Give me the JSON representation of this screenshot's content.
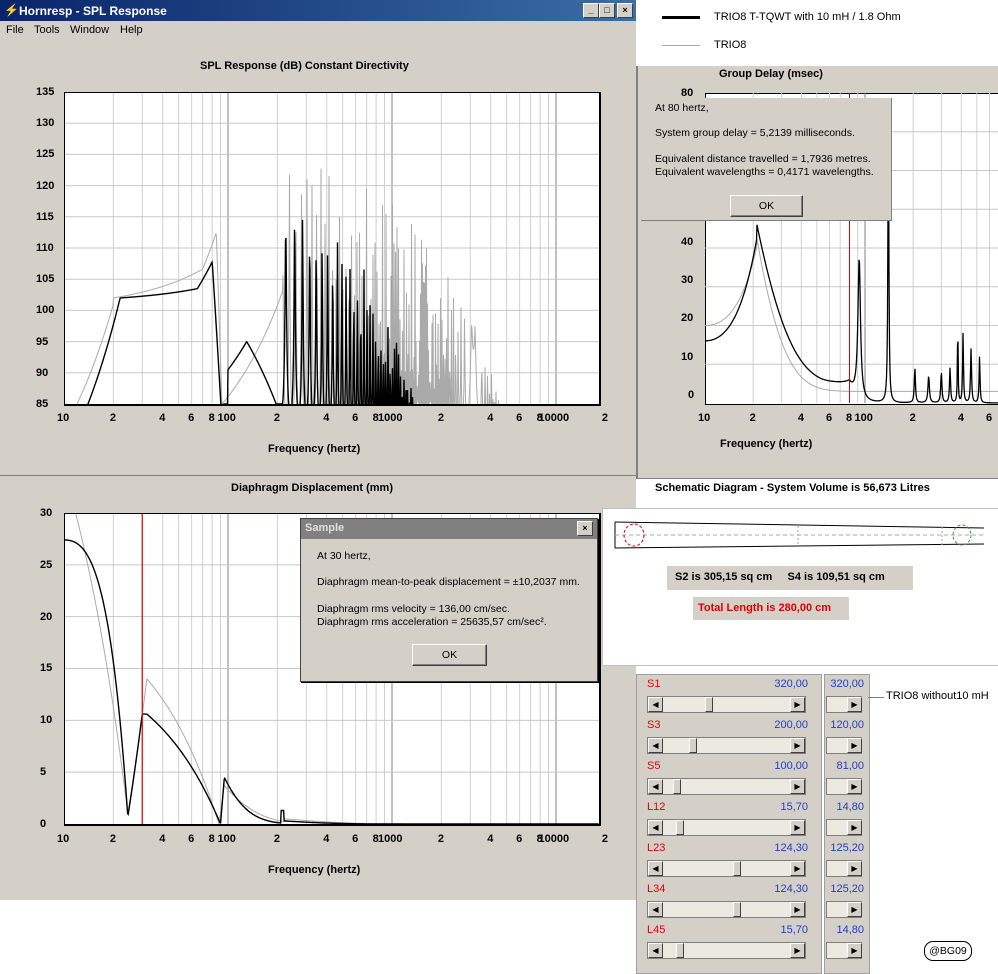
{
  "window": {
    "title": "Hornresp - SPL Response",
    "minimize": "_",
    "maximize": "□",
    "close": "×"
  },
  "menu": [
    "File",
    "Tools",
    "Window",
    "Help"
  ],
  "legend": {
    "series1": "TRIO8  T-TQWT with 10 mH / 1.8 Ohm",
    "series2": "TRIO8"
  },
  "colors": {
    "bg": "#d4d0c8",
    "plot_bg": "#ffffff",
    "series1": "#000000",
    "series2": "#aaaaaa",
    "marker": "#e00000",
    "title_bar": "#0a246a",
    "value_blue": "#1f3fbf"
  },
  "spl_chart": {
    "title": "SPL Response (dB)   Constant Directivity",
    "xlabel": "Frequency (hertz)",
    "y_ticks": [
      "135",
      "130",
      "125",
      "120",
      "115",
      "110",
      "105",
      "100",
      "95",
      "90",
      "85"
    ],
    "x_ticks": [
      "10",
      "2",
      "4",
      "6",
      "8",
      "100",
      "2",
      "4",
      "6",
      "8",
      "1000",
      "2",
      "4",
      "6",
      "8",
      "10000",
      "2"
    ]
  },
  "group_delay_chart": {
    "title": "Group Delay (msec)",
    "xlabel": "Frequency (hertz)",
    "y_ticks": [
      "80",
      "40",
      "30",
      "20",
      "10",
      "0"
    ],
    "x_ticks": [
      "10",
      "2",
      "4",
      "6",
      "8",
      "100",
      "2",
      "4",
      "6"
    ]
  },
  "gd_dialog": {
    "line1": "At 80 hertz,",
    "line2": "System group delay = 5,2139 milliseconds.",
    "line3": "Equivalent distance travelled = 1,7936 metres.",
    "line4": "Equivalent wavelengths = 0,4171 wavelengths.",
    "ok": "OK"
  },
  "disp_chart": {
    "title": "Diaphragm Displacement (mm)",
    "xlabel": "Frequency (hertz)",
    "y_ticks": [
      "30",
      "25",
      "20",
      "15",
      "10",
      "5",
      "0"
    ],
    "x_ticks": [
      "10",
      "2",
      "4",
      "6",
      "8",
      "100",
      "2",
      "4",
      "6",
      "8",
      "1000",
      "2",
      "4",
      "6",
      "8",
      "10000",
      "2"
    ]
  },
  "sample_dialog": {
    "title": "Sample",
    "close": "×",
    "line1": "At 30 hertz,",
    "line2": "Diaphragm mean-to-peak displacement = ±10,2037 mm.",
    "line3": "Diaphragm rms velocity = 136,00 cm/sec.",
    "line4": "Diaphragm rms acceleration = 25635,57 cm/sec².",
    "ok": "OK"
  },
  "schematic": {
    "title": "Schematic Diagram - System Volume is 56,673 Litres",
    "areas": "S2 is 305,15 sq cm     S4 is 109,51 sq cm",
    "total_length": "Total Length is 280,00 cm"
  },
  "params": [
    {
      "name": "S1",
      "value": "320,00",
      "alt": "320,00",
      "level": 0.33
    },
    {
      "name": "S3",
      "value": "200,00",
      "alt": "120,00",
      "level": 0.2
    },
    {
      "name": "S5",
      "value": "100,00",
      "alt": "81,00",
      "level": 0.08
    },
    {
      "name": "L12",
      "value": "15,70",
      "alt": "14,80",
      "level": 0.1
    },
    {
      "name": "L23",
      "value": "124,30",
      "alt": "125,20",
      "level": 0.55
    },
    {
      "name": "L34",
      "value": "124,30",
      "alt": "125,20",
      "level": 0.55
    },
    {
      "name": "L45",
      "value": "15,70",
      "alt": "14,80",
      "level": 0.1
    }
  ],
  "alt_label": "TRIO8 without10 mH",
  "badge": "@BG09"
}
